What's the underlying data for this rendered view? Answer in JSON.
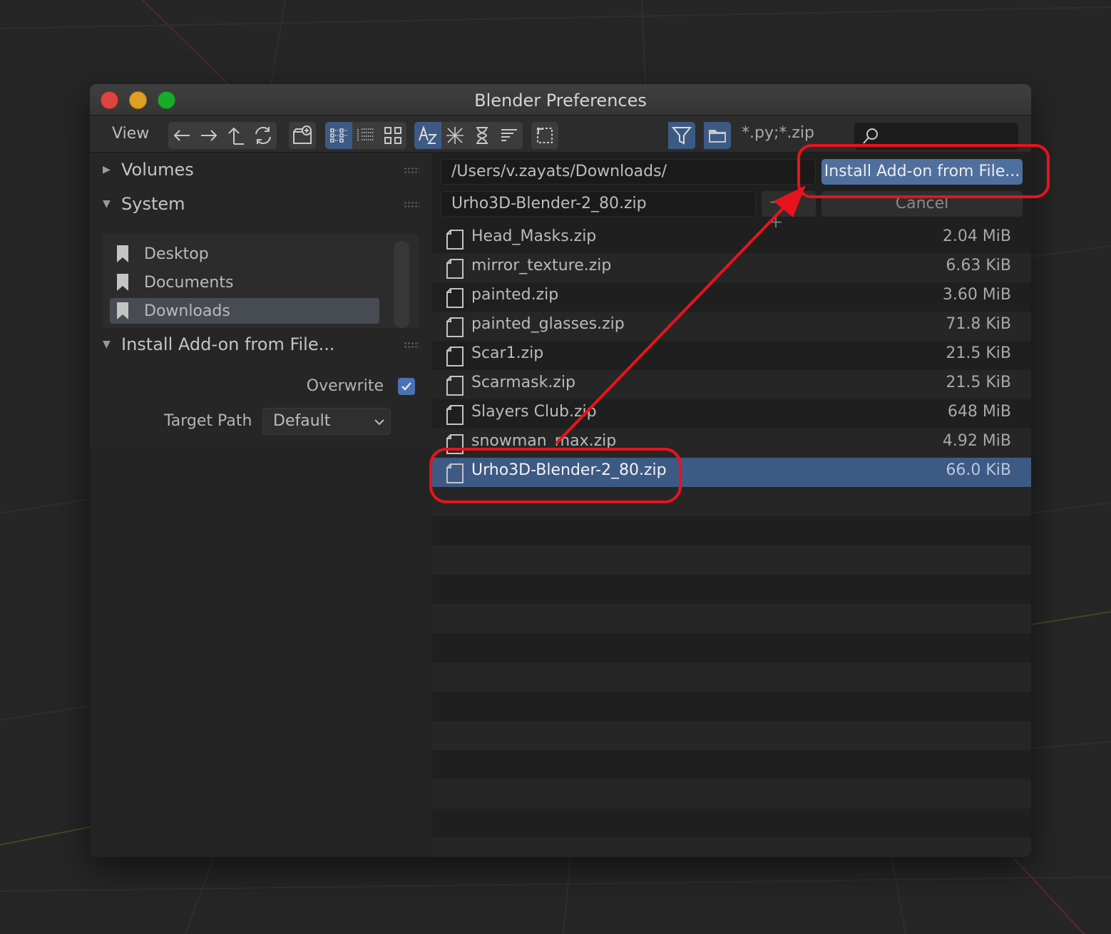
{
  "window": {
    "title": "Blender Preferences"
  },
  "toolbar": {
    "view_menu": "View",
    "filter_glob": "*.py;*.zip",
    "search_placeholder": ""
  },
  "sidebar": {
    "volumes_label": "Volumes",
    "system_label": "System",
    "bookmarks": [
      {
        "label": "Desktop",
        "selected": false
      },
      {
        "label": "Documents",
        "selected": false
      },
      {
        "label": "Downloads",
        "selected": true
      }
    ],
    "operator_panel_label": "Install Add-on from File...",
    "overwrite_label": "Overwrite",
    "overwrite_checked": true,
    "target_path_label": "Target Path",
    "target_path_value": "Default"
  },
  "browser": {
    "directory": "/Users/v.zayats/Downloads/",
    "filename": "Urho3D-Blender-2_80.zip",
    "stepper_label": "− +",
    "install_button": "Install Add-on from File...",
    "cancel_button": "Cancel",
    "files": [
      {
        "name": "Head_Masks.zip",
        "size": "2.04 MiB"
      },
      {
        "name": "mirror_texture.zip",
        "size": "6.63 KiB"
      },
      {
        "name": "painted.zip",
        "size": "3.60 MiB"
      },
      {
        "name": "painted_glasses.zip",
        "size": "71.8 KiB"
      },
      {
        "name": "Scar1.zip",
        "size": "21.5 KiB"
      },
      {
        "name": "Scarmask.zip",
        "size": "21.5 KiB"
      },
      {
        "name": "Slayers Club.zip",
        "size": "648 MiB"
      },
      {
        "name": "snowman_max.zip",
        "size": "4.92 MiB"
      },
      {
        "name": "Urho3D-Blender-2_80.zip",
        "size": "66.0 KiB"
      }
    ],
    "selected_index": 8
  },
  "colors": {
    "accent": "#3d5a85",
    "install_button": "#4f6f9e",
    "annotation": "#e8131c"
  }
}
